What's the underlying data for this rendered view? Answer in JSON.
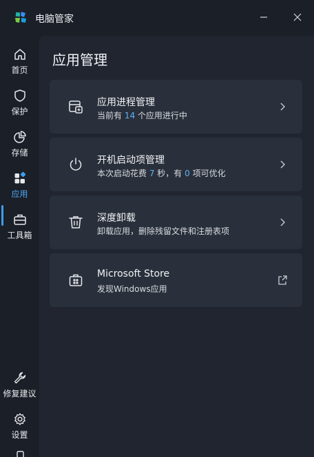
{
  "app": {
    "title": "电脑管家"
  },
  "window": {
    "minimize_icon": "minimize-icon",
    "close_icon": "close-icon"
  },
  "sidebar": {
    "items": [
      {
        "label": "首页",
        "icon": "home-icon"
      },
      {
        "label": "保护",
        "icon": "shield-icon"
      },
      {
        "label": "存储",
        "icon": "pie-chart-icon"
      },
      {
        "label": "应用",
        "icon": "apps-icon",
        "active": true
      },
      {
        "label": "工具箱",
        "icon": "toolbox-icon"
      },
      {
        "label": "修复建议",
        "icon": "wrench-icon"
      },
      {
        "label": "设置",
        "icon": "gear-icon"
      }
    ]
  },
  "main": {
    "title": "应用管理",
    "cards": [
      {
        "title": "应用进程管理",
        "subtitle": {
          "pre": "当前有 ",
          "value": "14",
          "post": " 个应用进行中"
        },
        "icon": "app-process-icon"
      },
      {
        "title": "开机启动项管理",
        "subtitle": {
          "pre": "本次启动花费 ",
          "value": "7",
          "mid": " 秒，有 ",
          "value2": "0",
          "post": " 项可优化"
        },
        "icon": "power-icon"
      },
      {
        "title": "深度卸载",
        "subtitle": {
          "text": "卸载应用，删除残留文件和注册表项"
        },
        "icon": "trash-icon"
      },
      {
        "title": "Microsoft Store",
        "subtitle": {
          "text": "发现Windows应用"
        },
        "icon": "store-icon"
      }
    ]
  },
  "colors": {
    "background": "#1b1f27",
    "panel": "#202530",
    "card": "#2a303b",
    "accent": "#3e9ef1",
    "highlight": "#5ab2f7"
  }
}
